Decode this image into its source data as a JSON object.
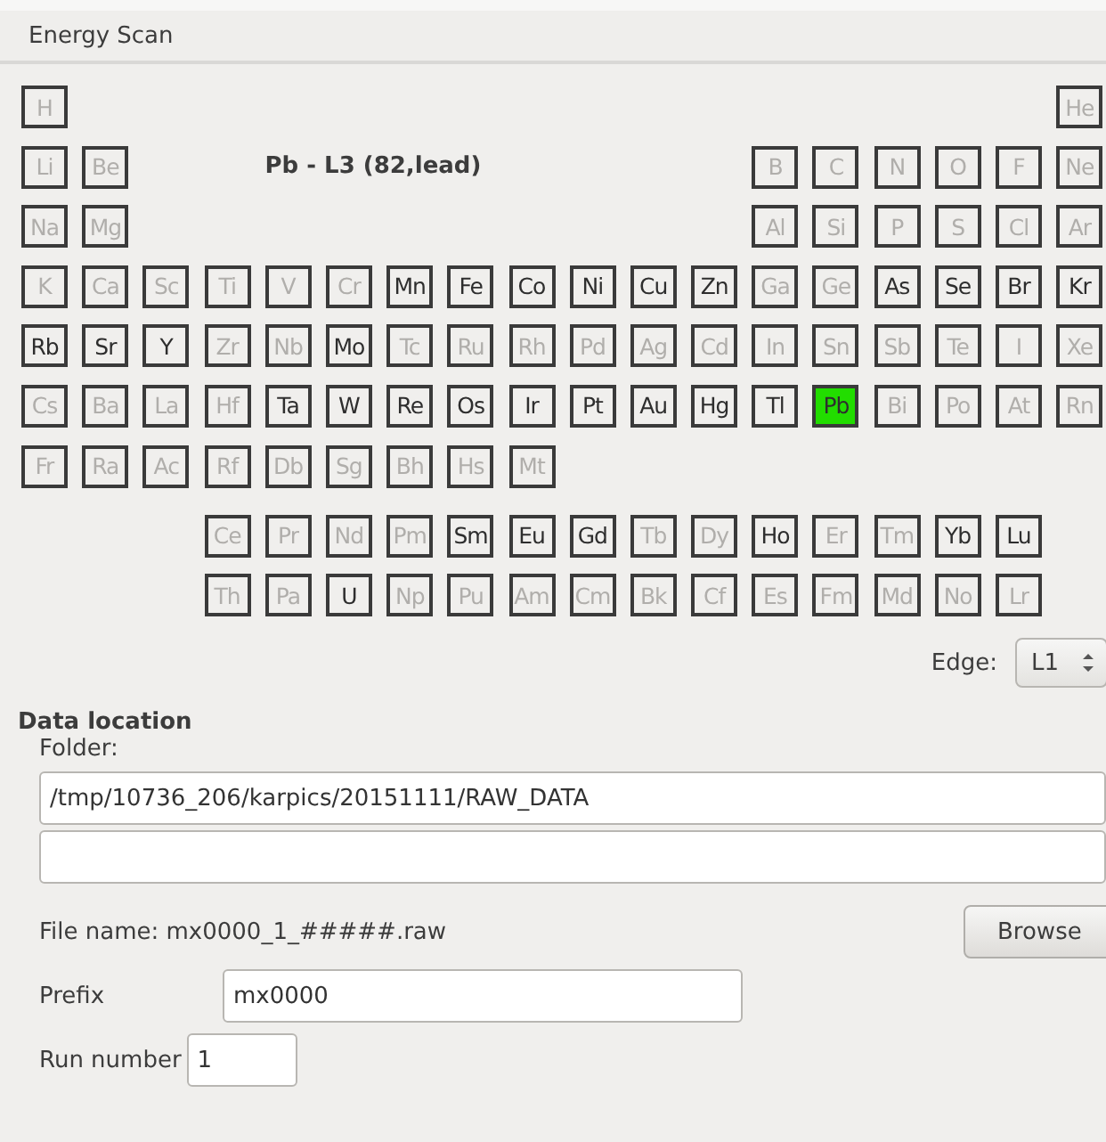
{
  "window": {
    "title": "Energy Scan"
  },
  "selection_label": "Pb - L3 (82,lead)",
  "periodic_table": {
    "main_rows": [
      {
        "left": [
          {
            "symbol": "H",
            "enabled": false,
            "selected": false
          }
        ],
        "right": [
          {
            "symbol": "He",
            "enabled": false,
            "selected": false
          }
        ]
      },
      {
        "left": [
          {
            "symbol": "Li",
            "enabled": false,
            "selected": false
          },
          {
            "symbol": "Be",
            "enabled": false,
            "selected": false
          }
        ],
        "right": [
          {
            "symbol": "B",
            "enabled": false,
            "selected": false
          },
          {
            "symbol": "C",
            "enabled": false,
            "selected": false
          },
          {
            "symbol": "N",
            "enabled": false,
            "selected": false
          },
          {
            "symbol": "O",
            "enabled": false,
            "selected": false
          },
          {
            "symbol": "F",
            "enabled": false,
            "selected": false
          },
          {
            "symbol": "Ne",
            "enabled": false,
            "selected": false
          }
        ]
      },
      {
        "left": [
          {
            "symbol": "Na",
            "enabled": false,
            "selected": false
          },
          {
            "symbol": "Mg",
            "enabled": false,
            "selected": false
          }
        ],
        "right": [
          {
            "symbol": "Al",
            "enabled": false,
            "selected": false
          },
          {
            "symbol": "Si",
            "enabled": false,
            "selected": false
          },
          {
            "symbol": "P",
            "enabled": false,
            "selected": false
          },
          {
            "symbol": "S",
            "enabled": false,
            "selected": false
          },
          {
            "symbol": "Cl",
            "enabled": false,
            "selected": false
          },
          {
            "symbol": "Ar",
            "enabled": false,
            "selected": false
          }
        ]
      },
      {
        "left": [
          {
            "symbol": "K",
            "enabled": false,
            "selected": false
          },
          {
            "symbol": "Ca",
            "enabled": false,
            "selected": false
          },
          {
            "symbol": "Sc",
            "enabled": false,
            "selected": false
          },
          {
            "symbol": "Ti",
            "enabled": false,
            "selected": false
          },
          {
            "symbol": "V",
            "enabled": false,
            "selected": false
          },
          {
            "symbol": "Cr",
            "enabled": false,
            "selected": false
          },
          {
            "symbol": "Mn",
            "enabled": true,
            "selected": false
          },
          {
            "symbol": "Fe",
            "enabled": true,
            "selected": false
          },
          {
            "symbol": "Co",
            "enabled": true,
            "selected": false
          },
          {
            "symbol": "Ni",
            "enabled": true,
            "selected": false
          },
          {
            "symbol": "Cu",
            "enabled": true,
            "selected": false
          },
          {
            "symbol": "Zn",
            "enabled": true,
            "selected": false
          },
          {
            "symbol": "Ga",
            "enabled": false,
            "selected": false
          },
          {
            "symbol": "Ge",
            "enabled": false,
            "selected": false
          },
          {
            "symbol": "As",
            "enabled": true,
            "selected": false
          },
          {
            "symbol": "Se",
            "enabled": true,
            "selected": false
          },
          {
            "symbol": "Br",
            "enabled": true,
            "selected": false
          },
          {
            "symbol": "Kr",
            "enabled": true,
            "selected": false
          }
        ],
        "right": []
      },
      {
        "left": [
          {
            "symbol": "Rb",
            "enabled": true,
            "selected": false
          },
          {
            "symbol": "Sr",
            "enabled": true,
            "selected": false
          },
          {
            "symbol": "Y",
            "enabled": true,
            "selected": false
          },
          {
            "symbol": "Zr",
            "enabled": false,
            "selected": false
          },
          {
            "symbol": "Nb",
            "enabled": false,
            "selected": false
          },
          {
            "symbol": "Mo",
            "enabled": true,
            "selected": false
          },
          {
            "symbol": "Tc",
            "enabled": false,
            "selected": false
          },
          {
            "symbol": "Ru",
            "enabled": false,
            "selected": false
          },
          {
            "symbol": "Rh",
            "enabled": false,
            "selected": false
          },
          {
            "symbol": "Pd",
            "enabled": false,
            "selected": false
          },
          {
            "symbol": "Ag",
            "enabled": false,
            "selected": false
          },
          {
            "symbol": "Cd",
            "enabled": false,
            "selected": false
          },
          {
            "symbol": "In",
            "enabled": false,
            "selected": false
          },
          {
            "symbol": "Sn",
            "enabled": false,
            "selected": false
          },
          {
            "symbol": "Sb",
            "enabled": false,
            "selected": false
          },
          {
            "symbol": "Te",
            "enabled": false,
            "selected": false
          },
          {
            "symbol": "I",
            "enabled": false,
            "selected": false
          },
          {
            "symbol": "Xe",
            "enabled": false,
            "selected": false
          }
        ],
        "right": []
      },
      {
        "left": [
          {
            "symbol": "Cs",
            "enabled": false,
            "selected": false
          },
          {
            "symbol": "Ba",
            "enabled": false,
            "selected": false
          },
          {
            "symbol": "La",
            "enabled": false,
            "selected": false
          },
          {
            "symbol": "Hf",
            "enabled": false,
            "selected": false
          },
          {
            "symbol": "Ta",
            "enabled": true,
            "selected": false
          },
          {
            "symbol": "W",
            "enabled": true,
            "selected": false
          },
          {
            "symbol": "Re",
            "enabled": true,
            "selected": false
          },
          {
            "symbol": "Os",
            "enabled": true,
            "selected": false
          },
          {
            "symbol": "Ir",
            "enabled": true,
            "selected": false
          },
          {
            "symbol": "Pt",
            "enabled": true,
            "selected": false
          },
          {
            "symbol": "Au",
            "enabled": true,
            "selected": false
          },
          {
            "symbol": "Hg",
            "enabled": true,
            "selected": false
          },
          {
            "symbol": "Tl",
            "enabled": true,
            "selected": false
          },
          {
            "symbol": "Pb",
            "enabled": true,
            "selected": true
          },
          {
            "symbol": "Bi",
            "enabled": false,
            "selected": false
          },
          {
            "symbol": "Po",
            "enabled": false,
            "selected": false
          },
          {
            "symbol": "At",
            "enabled": false,
            "selected": false
          },
          {
            "symbol": "Rn",
            "enabled": false,
            "selected": false
          }
        ],
        "right": []
      },
      {
        "left": [
          {
            "symbol": "Fr",
            "enabled": false,
            "selected": false
          },
          {
            "symbol": "Ra",
            "enabled": false,
            "selected": false
          },
          {
            "symbol": "Ac",
            "enabled": false,
            "selected": false
          },
          {
            "symbol": "Rf",
            "enabled": false,
            "selected": false
          },
          {
            "symbol": "Db",
            "enabled": false,
            "selected": false
          },
          {
            "symbol": "Sg",
            "enabled": false,
            "selected": false
          },
          {
            "symbol": "Bh",
            "enabled": false,
            "selected": false
          },
          {
            "symbol": "Hs",
            "enabled": false,
            "selected": false
          },
          {
            "symbol": "Mt",
            "enabled": false,
            "selected": false
          }
        ],
        "right": []
      }
    ],
    "f_rows": [
      [
        {
          "symbol": "Ce",
          "enabled": false,
          "selected": false
        },
        {
          "symbol": "Pr",
          "enabled": false,
          "selected": false
        },
        {
          "symbol": "Nd",
          "enabled": false,
          "selected": false
        },
        {
          "symbol": "Pm",
          "enabled": false,
          "selected": false
        },
        {
          "symbol": "Sm",
          "enabled": true,
          "selected": false
        },
        {
          "symbol": "Eu",
          "enabled": true,
          "selected": false
        },
        {
          "symbol": "Gd",
          "enabled": true,
          "selected": false
        },
        {
          "symbol": "Tb",
          "enabled": false,
          "selected": false
        },
        {
          "symbol": "Dy",
          "enabled": false,
          "selected": false
        },
        {
          "symbol": "Ho",
          "enabled": true,
          "selected": false
        },
        {
          "symbol": "Er",
          "enabled": false,
          "selected": false
        },
        {
          "symbol": "Tm",
          "enabled": false,
          "selected": false
        },
        {
          "symbol": "Yb",
          "enabled": true,
          "selected": false
        },
        {
          "symbol": "Lu",
          "enabled": true,
          "selected": false
        }
      ],
      [
        {
          "symbol": "Th",
          "enabled": false,
          "selected": false
        },
        {
          "symbol": "Pa",
          "enabled": false,
          "selected": false
        },
        {
          "symbol": "U",
          "enabled": true,
          "selected": false
        },
        {
          "symbol": "Np",
          "enabled": false,
          "selected": false
        },
        {
          "symbol": "Pu",
          "enabled": false,
          "selected": false
        },
        {
          "symbol": "Am",
          "enabled": false,
          "selected": false
        },
        {
          "symbol": "Cm",
          "enabled": false,
          "selected": false
        },
        {
          "symbol": "Bk",
          "enabled": false,
          "selected": false
        },
        {
          "symbol": "Cf",
          "enabled": false,
          "selected": false
        },
        {
          "symbol": "Es",
          "enabled": false,
          "selected": false
        },
        {
          "symbol": "Fm",
          "enabled": false,
          "selected": false
        },
        {
          "symbol": "Md",
          "enabled": false,
          "selected": false
        },
        {
          "symbol": "No",
          "enabled": false,
          "selected": false
        },
        {
          "symbol": "Lr",
          "enabled": false,
          "selected": false
        }
      ]
    ]
  },
  "edge": {
    "label": "Edge:",
    "value": "L1"
  },
  "data_location": {
    "title": "Data location",
    "folder_label": "Folder:",
    "folder": "/tmp/10736_206/karpics/20151111/RAW_DATA",
    "file_name": "File name: mx0000_1_#####.raw",
    "browse_button": "Browse",
    "prefix_label": "Prefix",
    "prefix": "mx0000",
    "run_number_label": "Run number",
    "run_number": "1"
  }
}
